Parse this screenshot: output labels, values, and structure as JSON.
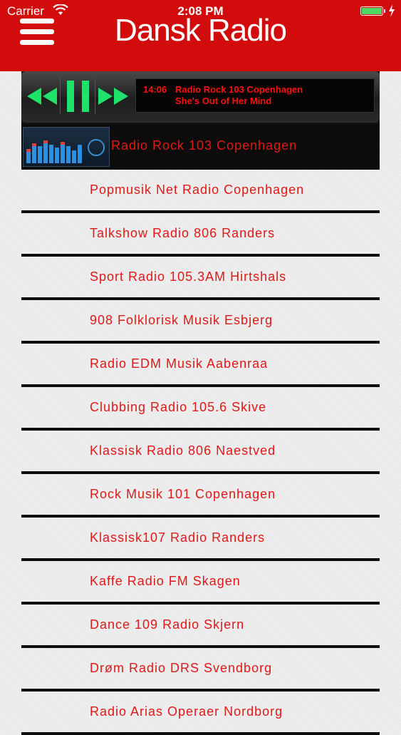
{
  "status": {
    "carrier": "Carrier",
    "time": "2:08 PM"
  },
  "header": {
    "title": "Dansk Radio"
  },
  "player": {
    "display_time": "14:06",
    "display_station": "Radio Rock 103 Copenhagen",
    "display_song": "She's Out of Her Mind",
    "now_playing": "Radio Rock 103 Copenhagen"
  },
  "stations": [
    "Popmusik Net Radio Copenhagen",
    "Talkshow Radio 806 Randers",
    "Sport Radio 105.3AM Hirtshals",
    "908 Folklorisk Musik Esbjerg",
    "Radio EDM Musik Aabenraa",
    "Clubbing Radio 105.6 Skive",
    "Klassisk Radio 806 Naestved",
    "Rock Musik 101 Copenhagen",
    "Klassisk107 Radio Randers",
    "Kaffe Radio FM Skagen",
    "Dance 109 Radio Skjern",
    "Drøm Radio DRS Svendborg",
    "Radio Arias Operaer Nordborg"
  ],
  "colors": {
    "header": "#d20c0c",
    "accent_text": "#e01818",
    "controls": "#1ee36a"
  }
}
